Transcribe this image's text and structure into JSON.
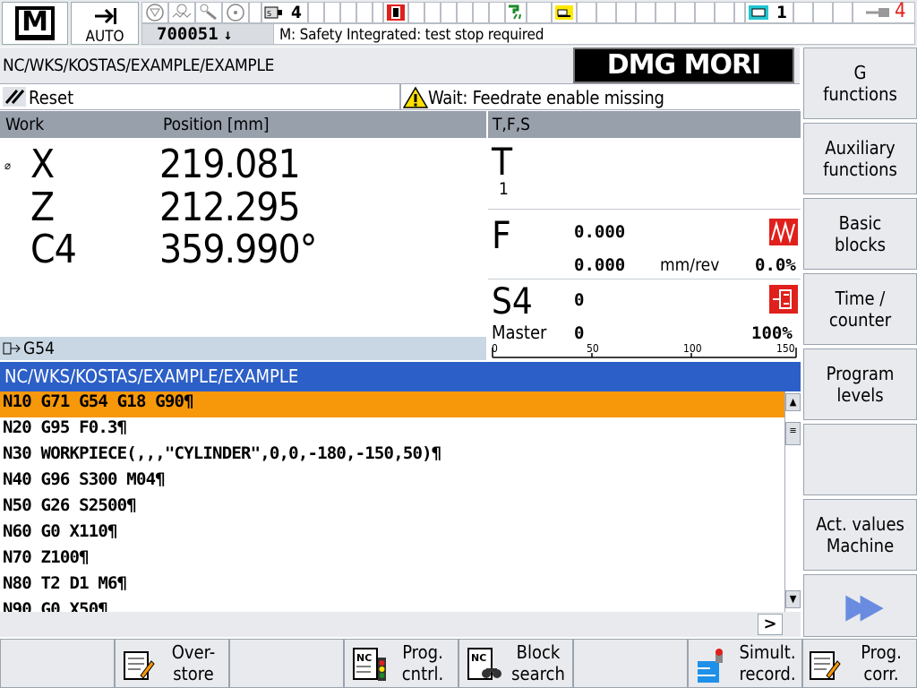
{
  "header": {
    "mode": "AUTO",
    "channel_num": "4",
    "axis_count": "1",
    "program_number": "700051",
    "alarm": "M: Safety Integrated: test stop required",
    "right_num": "4"
  },
  "path": "NC/WKS/KOSTAS/EXAMPLE/EXAMPLE",
  "logo": "DMG MORI",
  "status": {
    "reset": "Reset",
    "wait": "Wait: Feedrate enable missing"
  },
  "position": {
    "col_work": "Work",
    "col_position": "Position [mm]",
    "axes": [
      {
        "name": "X",
        "value": "219.081"
      },
      {
        "name": "Z",
        "value": "212.295"
      },
      {
        "name": "C4",
        "value": "359.990°"
      }
    ],
    "diameter_symbol": "⌀",
    "frame": "G54"
  },
  "tfs": {
    "title": "T,F,S",
    "t_label": "T",
    "t_num": "1",
    "f_label": "F",
    "f_val1": "0.000",
    "f_val2": "0.000",
    "f_unit": "mm/rev",
    "f_override": "0.0%",
    "s_label": "S4",
    "s_val": "0",
    "master_label": "Master",
    "master_val": "0",
    "s_override": "100%",
    "scale_0": "0",
    "scale_50": "50",
    "scale_100": "100",
    "scale_150": "150"
  },
  "program": {
    "title": "NC/WKS/KOSTAS/EXAMPLE/EXAMPLE",
    "lines": [
      "N10 G71 G54 G18 G90¶",
      "N20 G95 F0.3¶",
      "N30 WORKPIECE(,,,\"CYLINDER\",0,0,-180,-150,50)¶",
      "N40 G96 S300 M04¶",
      "N50 G26 S2500¶",
      "N60 G0 X110¶",
      "N70 Z100¶",
      "N80 T2 D1 M6¶",
      "N90 G0 X50¶"
    ]
  },
  "vertical_softkeys": [
    "G\nfunctions",
    "Auxiliary\nfunctions",
    "Basic\nblocks",
    "Time /\ncounter",
    "Program\nlevels",
    "",
    "Act. values\nMachine",
    "▶▶"
  ],
  "horizontal_softkeys": {
    "overstore": "Over-\nstore",
    "prog_cntrl": "Prog.\ncntrl.",
    "block_search": "Block\nsearch",
    "simult_record": "Simult.\nrecord.",
    "prog_corr": "Prog.\ncorr."
  },
  "colors": {
    "selected_line": "#f6980a",
    "header_blue": "#2c5fc7",
    "alarm_red": "#e0201c",
    "panel_gray": "#e8eaee"
  }
}
